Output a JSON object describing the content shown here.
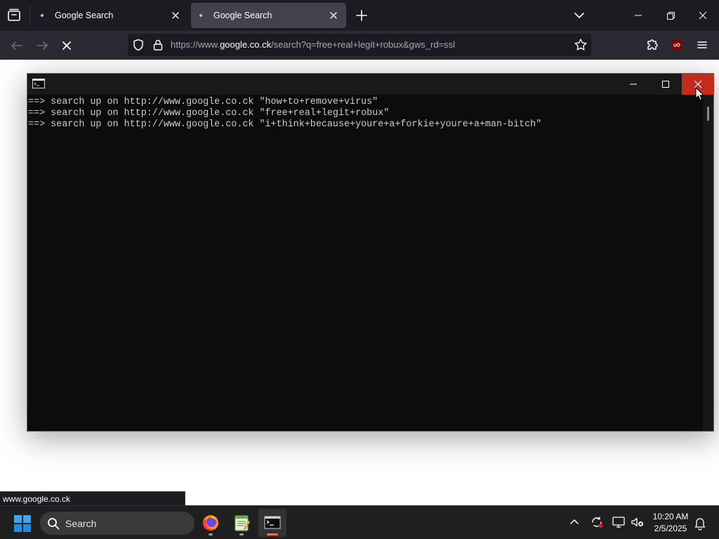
{
  "browser": {
    "tabs": [
      {
        "title": "Google Search",
        "active": false
      },
      {
        "title": "Google Search",
        "active": true
      }
    ],
    "url": {
      "prefix": "https://www.",
      "domain": "google.co.ck",
      "rest": "/search?q=free+real+legit+robux&gws_rd=ssl"
    },
    "status_link": "www.google.co.ck",
    "icons": {
      "tab_list": "tab-list-icon",
      "new_tab": "plus-icon",
      "list_all_tabs": "chevron-down-icon",
      "back": "arrow-left-icon",
      "forward": "arrow-right-icon",
      "stop": "close-icon",
      "tracking": "shield-icon",
      "security": "lock-icon",
      "bookmark": "star-icon",
      "extensions": "puzzle-icon",
      "ublock": "ublock-origin-icon",
      "menu": "hamburger-icon"
    },
    "ublock_label": "uO"
  },
  "console": {
    "lines": [
      "==> search up on http://www.google.co.ck \"how+to+remove+virus\"",
      "==> search up on http://www.google.co.ck \"free+real+legit+robux\"",
      "==> search up on http://www.google.co.ck \"i+think+because+youre+a+forkie+youre+a+man-bitch\""
    ],
    "close_color": "#c42b1c"
  },
  "taskbar": {
    "search_label": "Search",
    "apps": [
      "firefox-icon",
      "notepad-icon",
      "command-prompt-icon"
    ],
    "time": "10:20 AM",
    "date": "2/5/2025",
    "tray_icons": [
      "chevron-up-icon",
      "sync-icon",
      "network-icon",
      "volume-muted-icon",
      "notification-bell-icon"
    ]
  },
  "colors": {
    "tabbar_bg": "#1c1b22",
    "navbar_bg": "#2b2a33",
    "active_tab_bg": "#42414d",
    "console_bg": "#0c0c0c",
    "taskbar_bg": "#1f1f1f"
  }
}
